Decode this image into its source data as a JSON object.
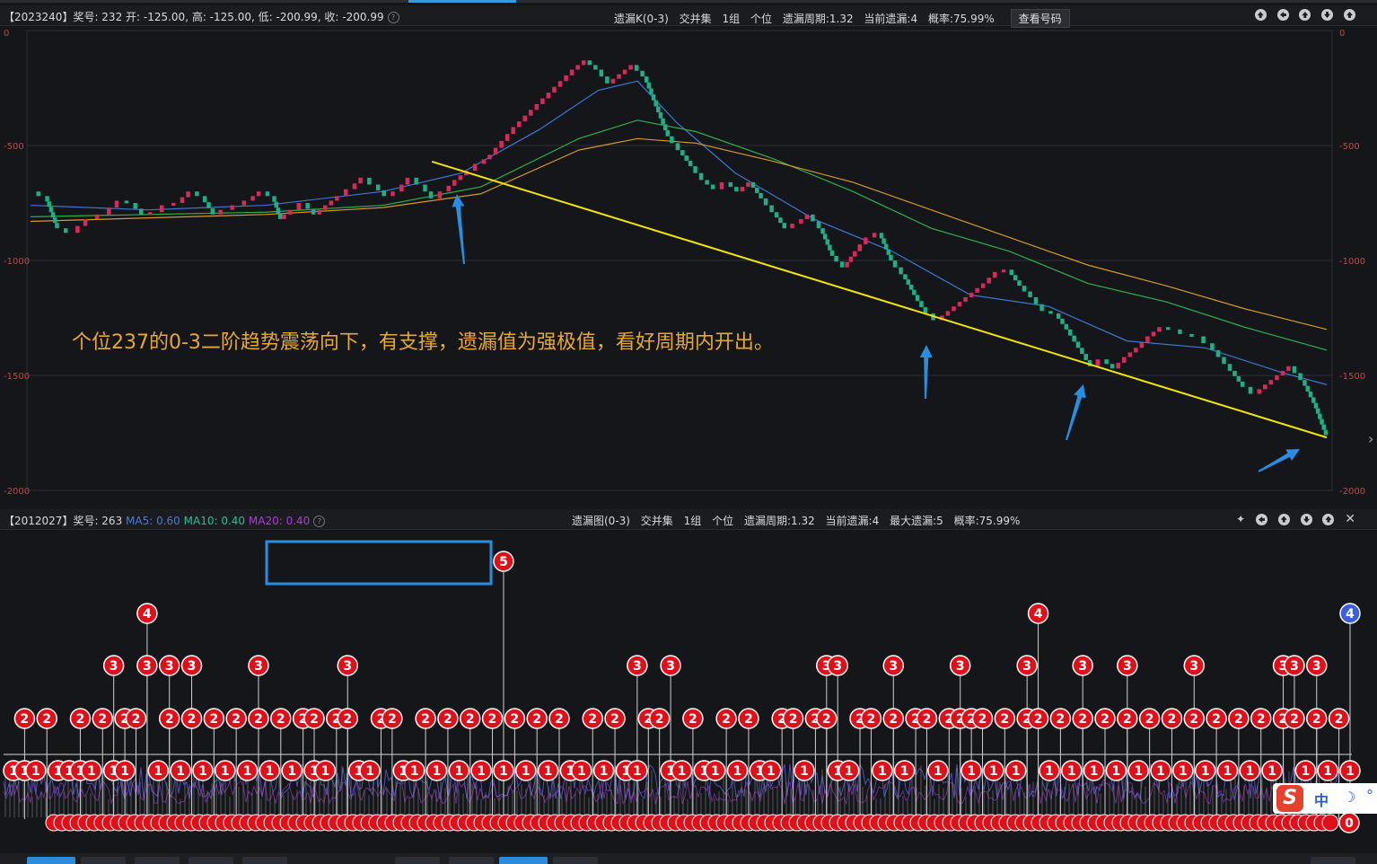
{
  "top_panel": {
    "header_left": "【2023240】奖号: 232  开: -125.00, 高: -125.00, 低: -200.99, 收: -200.99",
    "header_items": [
      "遗漏K(0-3)",
      "交并集",
      "1组",
      "个位",
      "遗漏周期:1.32",
      "当前遗漏:4",
      "概率:75.99%"
    ],
    "view_button": "查看号码"
  },
  "bottom_panel": {
    "header_id": "【2012027】奖号: 263",
    "ma5": "MA5: 0.60",
    "ma10": "MA10: 0.40",
    "ma20": "MA20: 0.40",
    "header_items": [
      "遗漏图(0-3)",
      "交并集",
      "1组",
      "个位",
      "遗漏周期:1.32",
      "当前遗漏:4",
      "最大遗漏:5",
      "概率:75.99%"
    ]
  },
  "annotation_text": "个位237的0-3二阶趋势震荡向下，有支撑，遗漏值为强极值，看好周期内开出。",
  "colors": {
    "up": "#d9295a",
    "down": "#1fae86",
    "ma_blue": "#3a78d4",
    "ma_green": "#2fae4e",
    "ma_orange": "#d49a26",
    "trendline": "#f2e600",
    "arrow": "#2a8ee0",
    "ball_red": "#e0101a",
    "ball_blue": "#3b5fe0",
    "highlight_box": "#2a8ee0"
  },
  "chart_data": [
    {
      "type": "renko-line",
      "ylim": [
        -2000,
        0
      ],
      "y_ticks": [
        "0",
        "-500",
        "-1000",
        "-1500",
        "-2000"
      ],
      "close_path": [
        [
          0,
          -700
        ],
        [
          8,
          -720
        ],
        [
          14,
          -860
        ],
        [
          22,
          -880
        ],
        [
          30,
          -820
        ],
        [
          38,
          -800
        ],
        [
          46,
          -740
        ],
        [
          52,
          -750
        ],
        [
          58,
          -800
        ],
        [
          64,
          -790
        ],
        [
          70,
          -760
        ],
        [
          76,
          -750
        ],
        [
          82,
          -700
        ],
        [
          88,
          -720
        ],
        [
          94,
          -800
        ],
        [
          100,
          -780
        ],
        [
          106,
          -760
        ],
        [
          112,
          -740
        ],
        [
          118,
          -700
        ],
        [
          124,
          -720
        ],
        [
          128,
          -820
        ],
        [
          134,
          -780
        ],
        [
          140,
          -750
        ],
        [
          146,
          -800
        ],
        [
          152,
          -760
        ],
        [
          158,
          -720
        ],
        [
          164,
          -690
        ],
        [
          170,
          -640
        ],
        [
          176,
          -670
        ],
        [
          182,
          -720
        ],
        [
          188,
          -700
        ],
        [
          194,
          -640
        ],
        [
          200,
          -670
        ],
        [
          206,
          -730
        ],
        [
          212,
          -700
        ],
        [
          218,
          -650
        ],
        [
          224,
          -610
        ],
        [
          230,
          -580
        ],
        [
          236,
          -540
        ],
        [
          242,
          -480
        ],
        [
          248,
          -420
        ],
        [
          254,
          -370
        ],
        [
          260,
          -320
        ],
        [
          266,
          -270
        ],
        [
          272,
          -220
        ],
        [
          278,
          -170
        ],
        [
          284,
          -130
        ],
        [
          290,
          -170
        ],
        [
          296,
          -230
        ],
        [
          302,
          -190
        ],
        [
          308,
          -150
        ],
        [
          314,
          -200
        ],
        [
          320,
          -330
        ],
        [
          326,
          -460
        ],
        [
          332,
          -520
        ],
        [
          338,
          -590
        ],
        [
          344,
          -650
        ],
        [
          350,
          -690
        ],
        [
          356,
          -660
        ],
        [
          362,
          -700
        ],
        [
          368,
          -660
        ],
        [
          374,
          -730
        ],
        [
          380,
          -790
        ],
        [
          386,
          -860
        ],
        [
          392,
          -840
        ],
        [
          398,
          -800
        ],
        [
          404,
          -860
        ],
        [
          410,
          -980
        ],
        [
          416,
          -1030
        ],
        [
          422,
          -960
        ],
        [
          428,
          -900
        ],
        [
          434,
          -880
        ],
        [
          440,
          -1000
        ],
        [
          446,
          -1060
        ],
        [
          452,
          -1150
        ],
        [
          458,
          -1230
        ],
        [
          464,
          -1260
        ],
        [
          470,
          -1220
        ],
        [
          476,
          -1180
        ],
        [
          482,
          -1140
        ],
        [
          488,
          -1100
        ],
        [
          494,
          -1050
        ],
        [
          500,
          -1040
        ],
        [
          506,
          -1110
        ],
        [
          512,
          -1160
        ],
        [
          518,
          -1220
        ],
        [
          524,
          -1230
        ],
        [
          530,
          -1300
        ],
        [
          536,
          -1380
        ],
        [
          542,
          -1460
        ],
        [
          548,
          -1430
        ],
        [
          554,
          -1470
        ],
        [
          560,
          -1420
        ],
        [
          566,
          -1380
        ],
        [
          572,
          -1330
        ],
        [
          578,
          -1290
        ],
        [
          584,
          -1300
        ],
        [
          590,
          -1320
        ],
        [
          596,
          -1330
        ],
        [
          602,
          -1360
        ],
        [
          608,
          -1420
        ],
        [
          614,
          -1480
        ],
        [
          620,
          -1550
        ],
        [
          626,
          -1580
        ],
        [
          632,
          -1540
        ],
        [
          638,
          -1500
        ],
        [
          644,
          -1460
        ],
        [
          650,
          -1520
        ],
        [
          656,
          -1620
        ],
        [
          662,
          -1760
        ]
      ],
      "ma_lines": {
        "blue": [
          [
            0,
            -760
          ],
          [
            60,
            -780
          ],
          [
            120,
            -760
          ],
          [
            180,
            -700
          ],
          [
            220,
            -620
          ],
          [
            260,
            -430
          ],
          [
            290,
            -260
          ],
          [
            310,
            -220
          ],
          [
            330,
            -400
          ],
          [
            360,
            -620
          ],
          [
            400,
            -820
          ],
          [
            440,
            -960
          ],
          [
            480,
            -1150
          ],
          [
            520,
            -1200
          ],
          [
            560,
            -1350
          ],
          [
            600,
            -1380
          ],
          [
            640,
            -1490
          ],
          [
            662,
            -1540
          ]
        ],
        "green": [
          [
            0,
            -810
          ],
          [
            60,
            -800
          ],
          [
            120,
            -790
          ],
          [
            180,
            -760
          ],
          [
            230,
            -680
          ],
          [
            280,
            -470
          ],
          [
            310,
            -390
          ],
          [
            340,
            -440
          ],
          [
            380,
            -560
          ],
          [
            420,
            -700
          ],
          [
            460,
            -860
          ],
          [
            500,
            -960
          ],
          [
            540,
            -1100
          ],
          [
            580,
            -1180
          ],
          [
            620,
            -1290
          ],
          [
            662,
            -1390
          ]
        ],
        "orange": [
          [
            0,
            -830
          ],
          [
            60,
            -815
          ],
          [
            120,
            -800
          ],
          [
            180,
            -770
          ],
          [
            230,
            -710
          ],
          [
            280,
            -520
          ],
          [
            310,
            -470
          ],
          [
            340,
            -490
          ],
          [
            380,
            -570
          ],
          [
            420,
            -660
          ],
          [
            460,
            -780
          ],
          [
            500,
            -900
          ],
          [
            540,
            -1020
          ],
          [
            580,
            -1110
          ],
          [
            620,
            -1210
          ],
          [
            662,
            -1300
          ]
        ]
      },
      "trendline": [
        [
          205,
          -570
        ],
        [
          662,
          -1770
        ]
      ]
    },
    {
      "type": "scatter",
      "ylim": [
        0,
        6
      ],
      "series": [
        {
          "points": [
            [
              0,
              1
            ],
            [
              1,
              2
            ],
            [
              1,
              1
            ],
            [
              2,
              1
            ],
            [
              3,
              2
            ],
            [
              4,
              1
            ],
            [
              5,
              1
            ],
            [
              6,
              2
            ],
            [
              6,
              1
            ],
            [
              7,
              1
            ],
            [
              8,
              2
            ],
            [
              9,
              3
            ],
            [
              9,
              1
            ],
            [
              10,
              2
            ],
            [
              10,
              1
            ],
            [
              11,
              2
            ],
            [
              12,
              3
            ],
            [
              12,
              4
            ],
            [
              13,
              1
            ],
            [
              14,
              2
            ],
            [
              14,
              3
            ],
            [
              15,
              1
            ],
            [
              16,
              2
            ],
            [
              16,
              3
            ],
            [
              17,
              1
            ],
            [
              18,
              2
            ],
            [
              19,
              1
            ],
            [
              20,
              2
            ],
            [
              21,
              1
            ],
            [
              22,
              3
            ],
            [
              22,
              2
            ],
            [
              23,
              1
            ],
            [
              24,
              2
            ],
            [
              25,
              1
            ],
            [
              26,
              2
            ],
            [
              27,
              2
            ],
            [
              27,
              1
            ],
            [
              28,
              1
            ],
            [
              29,
              2
            ],
            [
              30,
              3
            ],
            [
              30,
              2
            ],
            [
              31,
              1
            ],
            [
              32,
              1
            ],
            [
              33,
              2
            ],
            [
              34,
              2
            ],
            [
              35,
              1
            ],
            [
              36,
              1
            ],
            [
              37,
              2
            ],
            [
              38,
              1
            ],
            [
              39,
              2
            ],
            [
              40,
              1
            ],
            [
              41,
              2
            ],
            [
              42,
              1
            ],
            [
              43,
              2
            ],
            [
              44,
              5
            ],
            [
              44,
              1
            ],
            [
              45,
              2
            ],
            [
              46,
              1
            ],
            [
              47,
              2
            ],
            [
              48,
              1
            ],
            [
              49,
              2
            ],
            [
              50,
              1
            ],
            [
              51,
              1
            ],
            [
              52,
              2
            ],
            [
              53,
              1
            ],
            [
              54,
              2
            ],
            [
              55,
              1
            ],
            [
              56,
              3
            ],
            [
              56,
              1
            ],
            [
              57,
              2
            ],
            [
              58,
              2
            ],
            [
              59,
              3
            ],
            [
              59,
              1
            ],
            [
              60,
              1
            ],
            [
              61,
              2
            ],
            [
              62,
              1
            ],
            [
              63,
              1
            ],
            [
              64,
              2
            ],
            [
              65,
              1
            ],
            [
              66,
              2
            ],
            [
              67,
              1
            ],
            [
              68,
              1
            ],
            [
              69,
              2
            ],
            [
              70,
              2
            ],
            [
              71,
              1
            ],
            [
              72,
              2
            ],
            [
              73,
              3
            ],
            [
              73,
              2
            ],
            [
              74,
              3
            ],
            [
              74,
              1
            ],
            [
              75,
              1
            ],
            [
              76,
              2
            ],
            [
              77,
              2
            ],
            [
              78,
              1
            ],
            [
              79,
              3
            ],
            [
              79,
              2
            ],
            [
              80,
              1
            ],
            [
              81,
              2
            ],
            [
              82,
              2
            ],
            [
              83,
              1
            ],
            [
              84,
              2
            ],
            [
              85,
              3
            ],
            [
              85,
              2
            ],
            [
              86,
              2
            ],
            [
              86,
              1
            ],
            [
              87,
              2
            ],
            [
              88,
              1
            ],
            [
              89,
              2
            ],
            [
              90,
              1
            ],
            [
              91,
              3
            ],
            [
              91,
              2
            ],
            [
              92,
              2
            ],
            [
              92,
              4
            ],
            [
              93,
              1
            ],
            [
              94,
              2
            ],
            [
              95,
              1
            ],
            [
              96,
              3
            ],
            [
              96,
              2
            ],
            [
              97,
              1
            ],
            [
              98,
              2
            ],
            [
              99,
              1
            ],
            [
              100,
              3
            ],
            [
              100,
              2
            ],
            [
              101,
              1
            ],
            [
              102,
              2
            ],
            [
              103,
              1
            ],
            [
              104,
              2
            ],
            [
              105,
              1
            ],
            [
              106,
              3
            ],
            [
              106,
              2
            ],
            [
              107,
              1
            ],
            [
              108,
              2
            ],
            [
              109,
              1
            ],
            [
              110,
              2
            ],
            [
              111,
              1
            ],
            [
              112,
              2
            ],
            [
              113,
              1
            ],
            [
              114,
              3
            ],
            [
              114,
              2
            ],
            [
              115,
              3
            ],
            [
              115,
              2
            ],
            [
              116,
              1
            ],
            [
              117,
              3
            ],
            [
              117,
              2
            ],
            [
              118,
              1
            ],
            [
              119,
              2
            ],
            [
              120,
              1
            ]
          ]
        }
      ],
      "highlighted_point": [
        44,
        5
      ],
      "current_point": [
        120,
        4
      ],
      "zero_row_label": "0"
    }
  ]
}
